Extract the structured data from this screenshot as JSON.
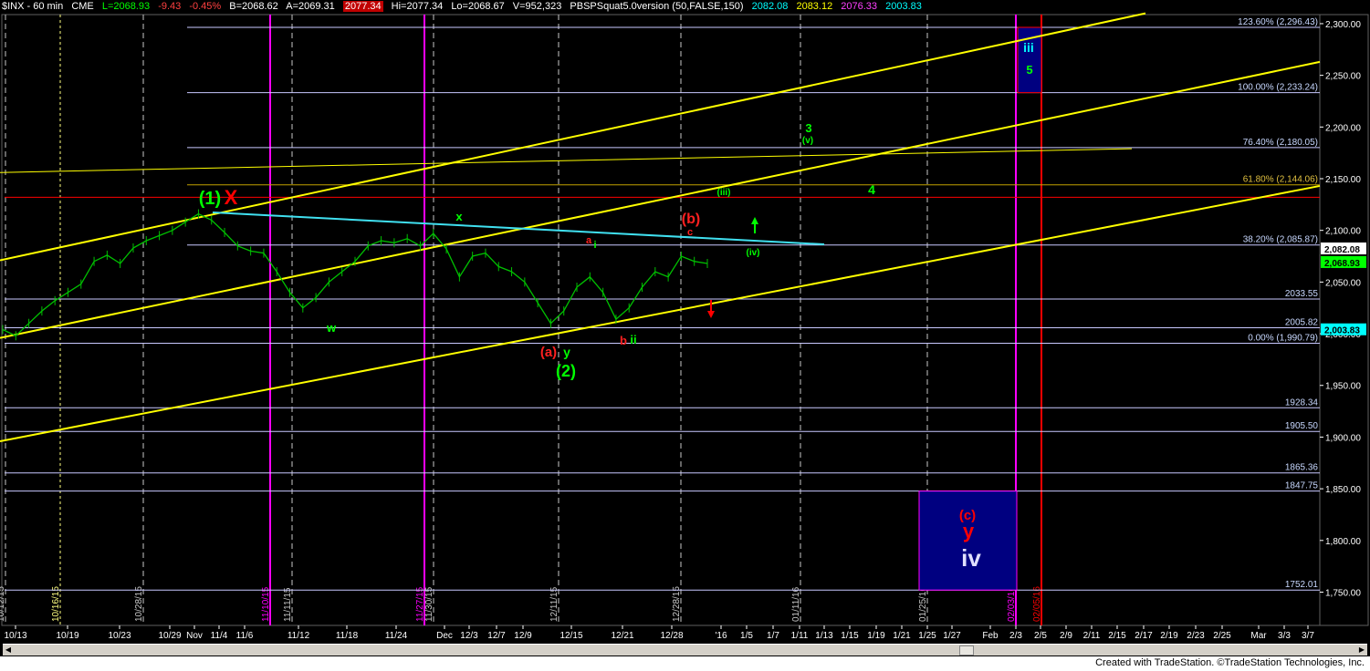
{
  "header": {
    "symbol": "$INX - 60 min",
    "exchange": "CME",
    "last": "L=2068.93",
    "change": "-9.43",
    "pct": "-0.45%",
    "bid": "B=2068.62",
    "ask": "A=2069.31",
    "hi_box": "2077.34",
    "hi": "Hi=2077.34",
    "lo": "Lo=2068.67",
    "volume": "V=952,323",
    "indicator": "PBSPSquat5.0version (50,FALSE,150)",
    "v1": "2082.08",
    "v2": "2083.12",
    "v3": "2076.33",
    "v4": "2003.83"
  },
  "colors": {
    "background": "#000000",
    "price_bars": "#00c000",
    "channel": "#ffff00",
    "fib_lines": "#c8c8ff",
    "red": "#ff0000",
    "magenta": "#ff00ff",
    "cyan_trend": "#40e0f0",
    "wave_green": "#00ff00",
    "wave_red": "#ff2020",
    "box_blue": "#000080"
  },
  "chart_data": {
    "type": "line",
    "title": "$INX - 60 min",
    "ylim": [
      1725,
      2310
    ],
    "y_ticks": [
      1750,
      1800,
      1850,
      1900,
      1950,
      2000,
      2050,
      2100,
      2150,
      2200,
      2250,
      2300
    ],
    "y_tick_labels": [
      "1,750.00",
      "1,800.00",
      "1,850.00",
      "1,900.00",
      "1,950.00",
      "2,000.00",
      "2,050.00",
      "2,100.00",
      "2,150.00",
      "2,200.00",
      "2,250.00",
      "2,300.00"
    ],
    "x_labels": [
      "10/13",
      "10/19",
      "10/23",
      "10/29",
      "Nov",
      "11/4",
      "11/6",
      "11/12",
      "11/18",
      "11/24",
      "Dec",
      "12/3",
      "12/7",
      "12/9",
      "12/15",
      "12/21",
      "12/28",
      "'16",
      "1/5",
      "1/7",
      "1/11",
      "1/13",
      "1/15",
      "1/19",
      "1/21",
      "1/25",
      "1/27",
      "Feb",
      "2/3",
      "2/5",
      "2/9",
      "2/11",
      "2/15",
      "2/17",
      "2/19",
      "2/23",
      "2/25",
      "Mar",
      "3/3",
      "3/7"
    ],
    "price_series": {
      "name": "$INX",
      "points": [
        [
          "10/13",
          2004
        ],
        [
          "10/14",
          1998
        ],
        [
          "10/15",
          2010
        ],
        [
          "10/16",
          2022
        ],
        [
          "10/19",
          2032
        ],
        [
          "10/21",
          2040
        ],
        [
          "10/22",
          2048
        ],
        [
          "10/23",
          2070
        ],
        [
          "10/26",
          2076
        ],
        [
          "10/27",
          2068
        ],
        [
          "10/28",
          2083
        ],
        [
          "10/29",
          2090
        ],
        [
          "10/30",
          2095
        ],
        [
          "Nov",
          2100
        ],
        [
          "11/3",
          2108
        ],
        [
          "11/4",
          2116
        ],
        [
          "11/5",
          2110
        ],
        [
          "11/6",
          2098
        ],
        [
          "11/9",
          2085
        ],
        [
          "11/10",
          2080
        ],
        [
          "11/11",
          2078
        ],
        [
          "11/12",
          2060
        ],
        [
          "11/13",
          2040
        ],
        [
          "11/16",
          2025
        ],
        [
          "11/17",
          2035
        ],
        [
          "11/18",
          2050
        ],
        [
          "11/19",
          2060
        ],
        [
          "11/20",
          2070
        ],
        [
          "11/23",
          2085
        ],
        [
          "11/24",
          2090
        ],
        [
          "11/25",
          2088
        ],
        [
          "11/27",
          2092
        ],
        [
          "11/30",
          2085
        ],
        [
          "Dec",
          2097
        ],
        [
          "12/2",
          2082
        ],
        [
          "12/3",
          2055
        ],
        [
          "12/4",
          2075
        ],
        [
          "12/7",
          2078
        ],
        [
          "12/8",
          2065
        ],
        [
          "12/9",
          2060
        ],
        [
          "12/10",
          2050
        ],
        [
          "12/11",
          2030
        ],
        [
          "12/14",
          2010
        ],
        [
          "12/15",
          2022
        ],
        [
          "12/16",
          2045
        ],
        [
          "12/17",
          2055
        ],
        [
          "12/18",
          2040
        ],
        [
          "12/21",
          2014
        ],
        [
          "12/22",
          2025
        ],
        [
          "12/23",
          2045
        ],
        [
          "12/24",
          2060
        ],
        [
          "12/28",
          2055
        ],
        [
          "12/29",
          2075
        ],
        [
          "12/30",
          2070
        ],
        [
          "12/31",
          2068
        ]
      ]
    },
    "horizontal_levels": [
      {
        "label": "123.60% (2,296.43)",
        "value": 2296.43
      },
      {
        "label": "100.00% (2,233.24)",
        "value": 2233.24
      },
      {
        "label": "76.40% (2,180.05)",
        "value": 2180.05
      },
      {
        "label": "61.80% (2,144.06)",
        "value": 2144.06
      },
      {
        "label": "38.20% (2,085.87)",
        "value": 2085.87
      },
      {
        "label": "2033.55",
        "value": 2033.55
      },
      {
        "label": "2005.82",
        "value": 2005.82
      },
      {
        "label": "0.00% (1,990.79)",
        "value": 1990.79
      },
      {
        "label": "1928.34",
        "value": 1928.34
      },
      {
        "label": "1905.50",
        "value": 1905.5
      },
      {
        "label": "1865.36",
        "value": 1865.36
      },
      {
        "label": "1847.75",
        "value": 1847.75
      },
      {
        "label": "1752.01",
        "value": 1752.01
      }
    ],
    "price_tags": [
      {
        "label": "2,082.08",
        "value": 2082.08,
        "color": "#ffffff"
      },
      {
        "label": "2,068.93",
        "value": 2068.93,
        "color": "#00ff00"
      },
      {
        "label": "2,003.83",
        "value": 2003.83,
        "color": "#00ffff"
      }
    ],
    "vertical_date_labels": [
      {
        "label": "10/12/15",
        "style": "gray"
      },
      {
        "label": "10/16/15",
        "style": "yellow"
      },
      {
        "label": "10/28/15",
        "style": "gray"
      },
      {
        "label": "11/10/15",
        "style": "magenta"
      },
      {
        "label": "11/11/15",
        "style": "gray"
      },
      {
        "label": "11/27/15",
        "style": "magenta"
      },
      {
        "label": "11/30/15",
        "style": "gray"
      },
      {
        "label": "12/11/15",
        "style": "gray"
      },
      {
        "label": "12/28/15",
        "style": "gray"
      },
      {
        "label": "01/11/16",
        "style": "gray"
      },
      {
        "label": "01/25/16",
        "style": "gray"
      },
      {
        "label": "02/03/16",
        "style": "magenta"
      },
      {
        "label": "02/05/16",
        "style": "red"
      }
    ],
    "wave_labels": [
      {
        "text": "(1)",
        "color": "#00ff00"
      },
      {
        "text": "X",
        "color": "#ff0000"
      },
      {
        "text": "w",
        "color": "#00ff00"
      },
      {
        "text": "x",
        "color": "#00ff00"
      },
      {
        "text": "(a)",
        "color": "#ff2020"
      },
      {
        "text": "y",
        "color": "#00ff00"
      },
      {
        "text": "(2)",
        "color": "#00ff00"
      },
      {
        "text": "a",
        "color": "#ff2020"
      },
      {
        "text": "i",
        "color": "#00ff00"
      },
      {
        "text": "b",
        "color": "#ff2020"
      },
      {
        "text": "ii",
        "color": "#00ff00"
      },
      {
        "text": "(b)",
        "color": "#ff2020"
      },
      {
        "text": "c",
        "color": "#ff2020"
      },
      {
        "text": "(iii)",
        "color": "#00ff00"
      },
      {
        "text": "(iv)",
        "color": "#00ff00"
      },
      {
        "text": "3",
        "color": "#00ff00"
      },
      {
        "text": "(v)",
        "color": "#00ff00"
      },
      {
        "text": "4",
        "color": "#00ff00"
      },
      {
        "text": "iii",
        "color": "#00ffff"
      },
      {
        "text": "5",
        "color": "#00ff00"
      },
      {
        "text": "(c)",
        "color": "#ff0000"
      },
      {
        "text": "y",
        "color": "#ff0000"
      },
      {
        "text": "iv",
        "color": "#e0e0ff"
      }
    ],
    "arrows": [
      {
        "direction": "up",
        "color": "#00ff00"
      },
      {
        "direction": "down",
        "color": "#ff0000"
      }
    ],
    "grid": false,
    "legend": "none"
  },
  "footer": {
    "text": "Created with TradeStation. ©TradeStation Technologies, Inc."
  },
  "scrollbar": {
    "left_arrow": "◀",
    "right_arrow": "▶"
  }
}
